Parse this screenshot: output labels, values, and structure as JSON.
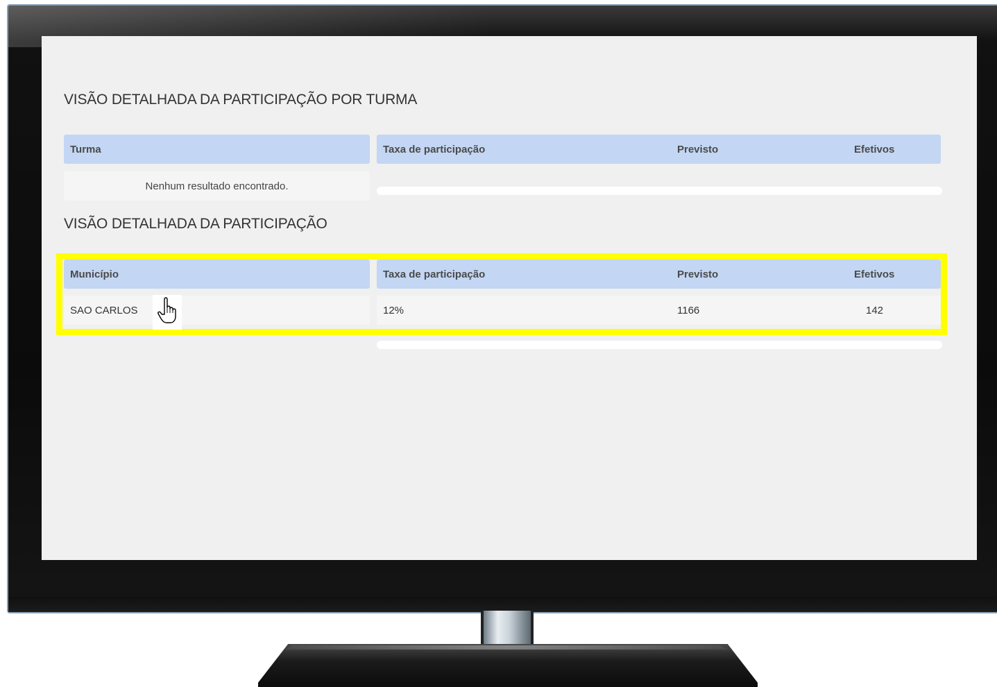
{
  "section1": {
    "title": "VISÃO DETALHADA DA PARTICIPAÇÃO POR TURMA",
    "headers": {
      "turma": "Turma",
      "taxa": "Taxa de participação",
      "previsto": "Previsto",
      "efetivos": "Efetivos"
    },
    "empty_message": "Nenhum resultado encontrado."
  },
  "section2": {
    "title": "VISÃO DETALHADA DA PARTICIPAÇÃO",
    "headers": {
      "municipio": "Município",
      "taxa": "Taxa de participação",
      "previsto": "Previsto",
      "efetivos": "Efetivos"
    },
    "rows": [
      {
        "municipio": "SAO CARLOS",
        "taxa": "12%",
        "previsto": "1166",
        "efetivos": "142"
      }
    ]
  },
  "colors": {
    "header_bg": "#c3d6f3",
    "highlight": "#ffff00",
    "screen_bg": "#f0f0f0"
  },
  "icons": {
    "cursor": "hand-pointer-icon"
  }
}
